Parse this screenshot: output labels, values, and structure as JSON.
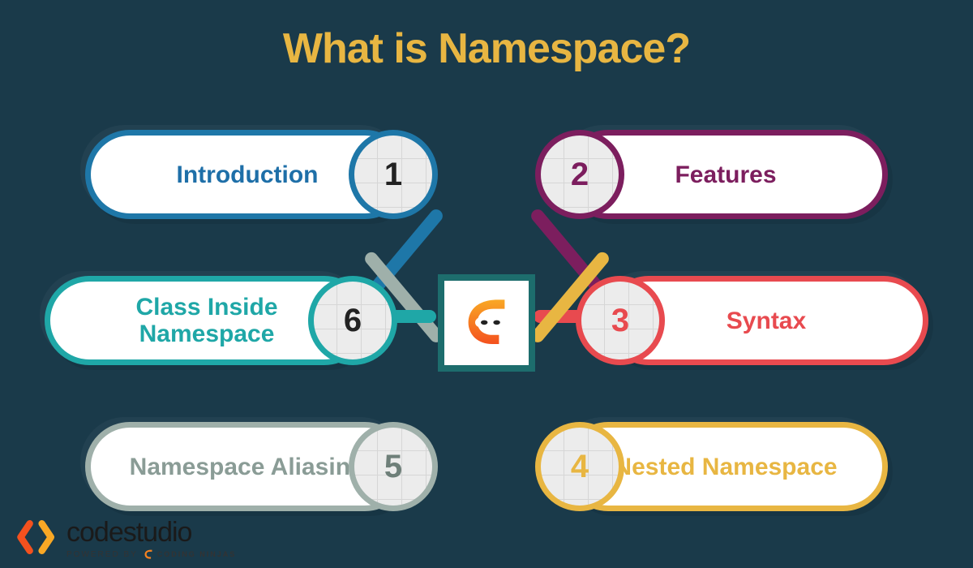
{
  "title": "What is Namespace?",
  "colors": {
    "accent_title": "#e8b642",
    "bg": "#1a3a4a"
  },
  "center_icon": "ninja-mask-icon",
  "items": [
    {
      "n": "1",
      "label": "Introduction",
      "side": "left",
      "row": 0,
      "color": "#1e77a8",
      "text": "#1e6fa8"
    },
    {
      "n": "2",
      "label": "Features",
      "side": "right",
      "row": 0,
      "color": "#7c1e5e",
      "text": "#7c1e5e"
    },
    {
      "n": "3",
      "label": "Syntax",
      "side": "right",
      "row": 1,
      "color": "#e84a4f",
      "text": "#e84a4f"
    },
    {
      "n": "4",
      "label": "Nested Namespace",
      "side": "right",
      "row": 2,
      "color": "#e8b642",
      "text": "#e8b642"
    },
    {
      "n": "5",
      "label": "Namespace Aliasing",
      "side": "left",
      "row": 2,
      "color": "#9fb0aa",
      "text": "#8a9c96"
    },
    {
      "n": "6",
      "label": "Class Inside Namespace",
      "side": "left",
      "row": 1,
      "color": "#1fa7a7",
      "text": "#1fa7a7"
    }
  ],
  "footer": {
    "brand": "codestudio",
    "powered_by": "POWERED BY",
    "partner": "CODING NINJAS"
  }
}
